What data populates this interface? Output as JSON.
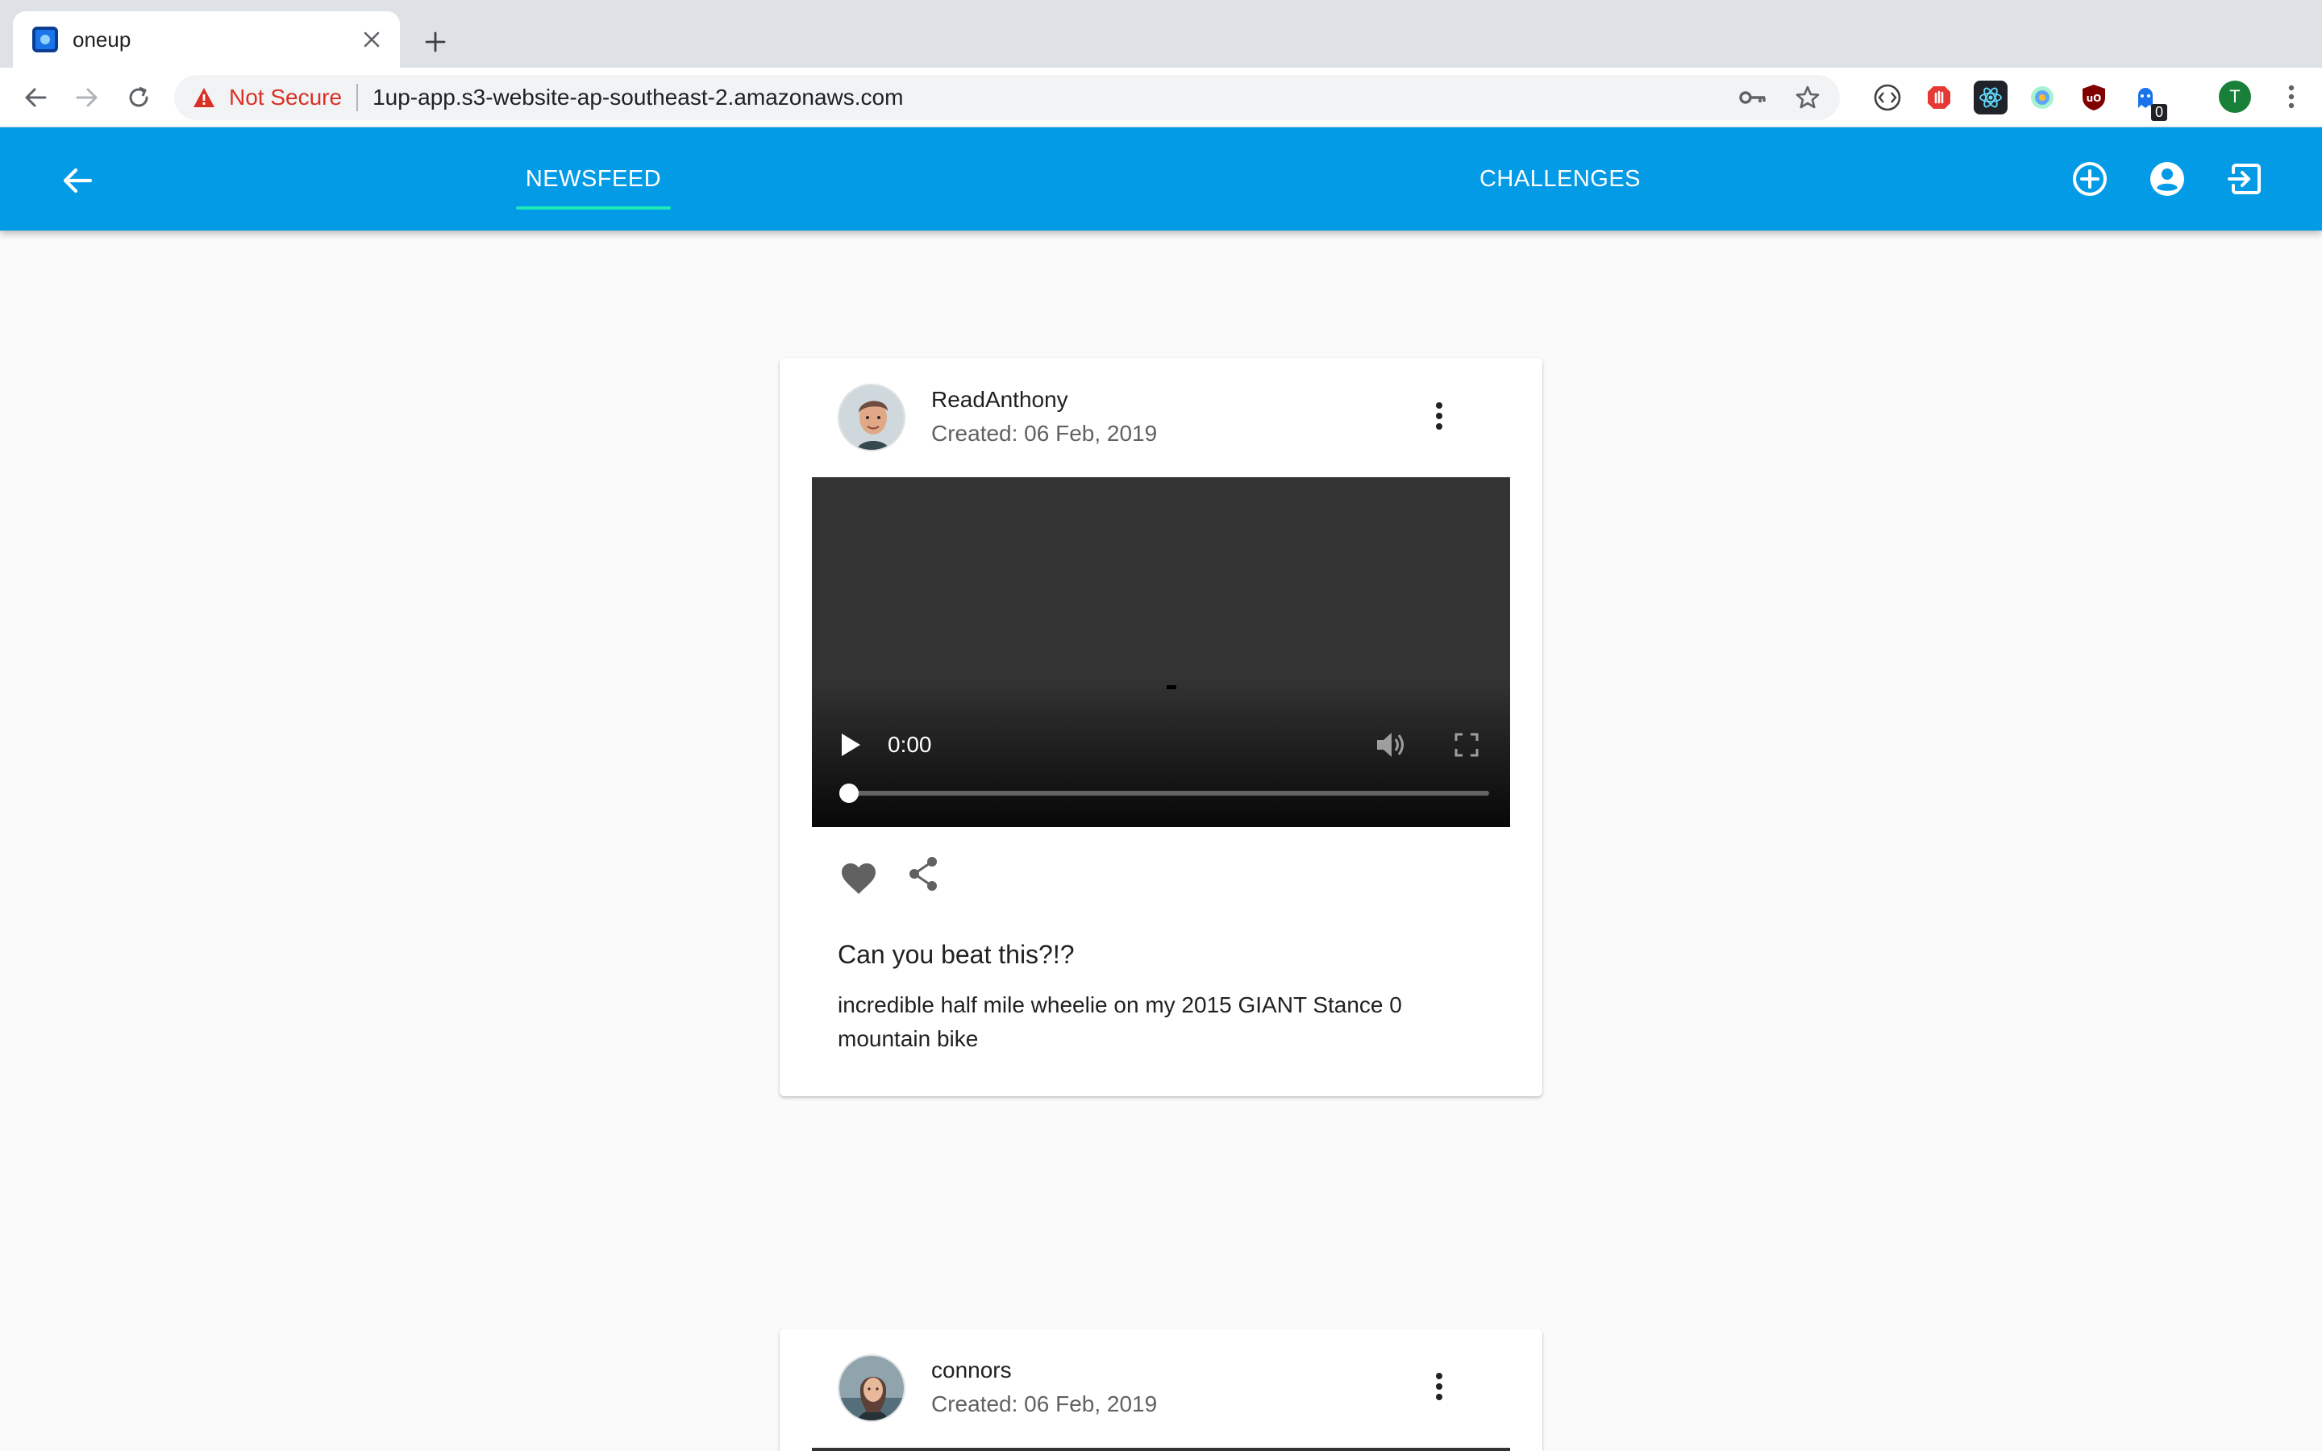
{
  "browser": {
    "tab_title": "oneup",
    "security_label": "Not Secure",
    "url": "1up-app.s3-website-ap-southeast-2.amazonaws.com",
    "profile_initial": "T",
    "extension_badge": "0",
    "accent": "#d93025"
  },
  "appbar": {
    "color": "#039be5",
    "tabs": [
      {
        "label": "NEWSFEED",
        "active": true
      },
      {
        "label": "CHALLENGES",
        "active": false
      }
    ]
  },
  "feed": {
    "posts": [
      {
        "username": "ReadAnthony",
        "created": "Created: 06 Feb, 2019",
        "video": {
          "time": "0:00",
          "progress": 0
        },
        "title": "Can you beat this?!?",
        "body": "incredible half mile wheelie on my 2015 GIANT Stance 0 mountain bike"
      },
      {
        "username": "connors",
        "created": "Created: 06 Feb, 2019"
      }
    ]
  }
}
